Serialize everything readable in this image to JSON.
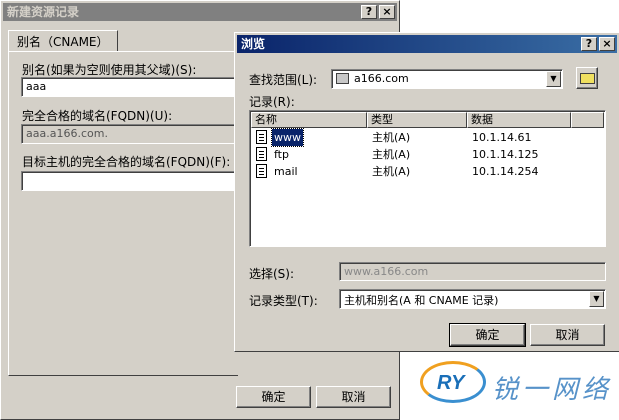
{
  "back_window": {
    "title": "新建资源记录",
    "tab_label": "别名（CNAME）",
    "alias_label": "别名(如果为空则使用其父域)(S):",
    "alias_value": "aaa",
    "fqdn_label": "完全合格的域名(FQDN)(U):",
    "fqdn_value": "aaa.a166.com.",
    "target_label": "目标主机的完全合格的域名(FQDN)(F):",
    "target_value": "",
    "ok_label": "确定",
    "cancel_label": "取消"
  },
  "browse_dialog": {
    "title": "浏览",
    "help_btn": "?",
    "close_btn": "×",
    "lookin_label": "查找范围(L):",
    "lookin_value": "a166.com",
    "records_label": "记录(R):",
    "columns": [
      "名称",
      "类型",
      "数据"
    ],
    "rows": [
      {
        "name": "www",
        "type": "主机(A)",
        "data": "10.1.14.61"
      },
      {
        "name": "ftp",
        "type": "主机(A)",
        "data": "10.1.14.125"
      },
      {
        "name": "mail",
        "type": "主机(A)",
        "data": "10.1.14.254"
      }
    ],
    "selection_label": "选择(S):",
    "selection_value": "www.a166.com",
    "record_type_label": "记录类型(T):",
    "record_type_value": "主机和别名(A 和 CNAME 记录)",
    "ok_label": "确定",
    "cancel_label": "取消"
  },
  "watermark": {
    "logo_text": "RY",
    "chinese_text": "锐一网络"
  },
  "colors": {
    "active_title": "#0a246a",
    "inactive_title": "#808080",
    "face": "#d4d0c8",
    "selection": "#0a246a"
  }
}
